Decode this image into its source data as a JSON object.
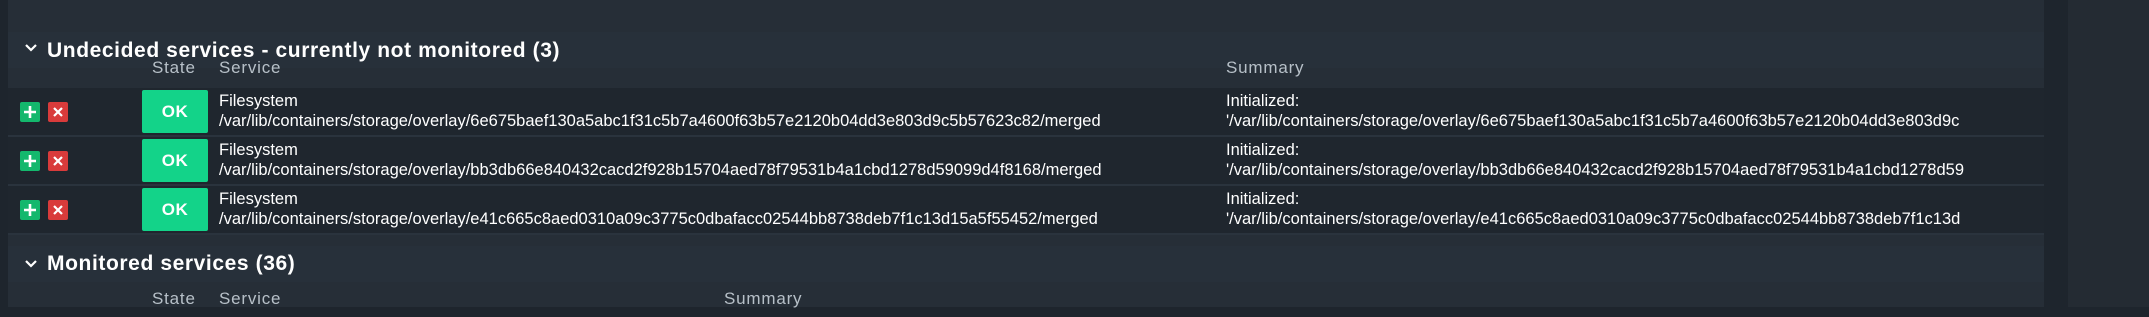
{
  "colors": {
    "ok_state": "#13d389",
    "add_button": "#14b86d",
    "remove_button": "#d93b3b",
    "background": "#1e252d"
  },
  "undecided": {
    "title": "Undecided services - currently not monitored (3)",
    "columns": {
      "state": "State",
      "service": "Service",
      "summary": "Summary"
    },
    "rows": [
      {
        "state": "OK",
        "service_line1": "Filesystem",
        "service_line2": "/var/lib/containers/storage/overlay/6e675baef130a5abc1f31c5b7a4600f63b57e2120b04dd3e803d9c5b57623c82/merged",
        "summary_line1": "Initialized:",
        "summary_line2": "'/var/lib/containers/storage/overlay/6e675baef130a5abc1f31c5b7a4600f63b57e2120b04dd3e803d9c"
      },
      {
        "state": "OK",
        "service_line1": "Filesystem",
        "service_line2": "/var/lib/containers/storage/overlay/bb3db66e840432cacd2f928b15704aed78f79531b4a1cbd1278d59099d4f8168/merged",
        "summary_line1": "Initialized:",
        "summary_line2": "'/var/lib/containers/storage/overlay/bb3db66e840432cacd2f928b15704aed78f79531b4a1cbd1278d59"
      },
      {
        "state": "OK",
        "service_line1": "Filesystem",
        "service_line2": "/var/lib/containers/storage/overlay/e41c665c8aed0310a09c3775c0dbafacc02544bb8738deb7f1c13d15a5f55452/merged",
        "summary_line1": "Initialized:",
        "summary_line2": "'/var/lib/containers/storage/overlay/e41c665c8aed0310a09c3775c0dbafacc02544bb8738deb7f1c13d"
      }
    ]
  },
  "monitored": {
    "title": "Monitored services (36)",
    "columns": {
      "state": "State",
      "service": "Service",
      "summary": "Summary"
    }
  }
}
